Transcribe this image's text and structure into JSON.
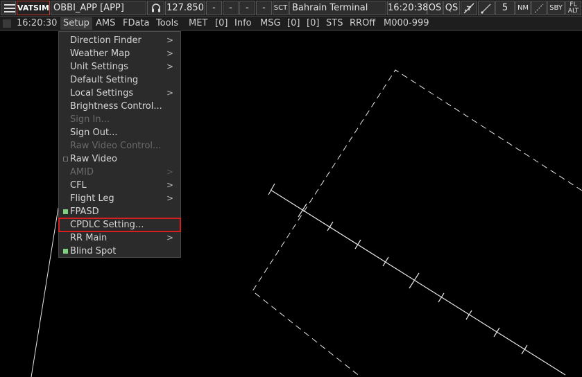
{
  "topbar": {
    "logo": "VATSIM",
    "position": "OBBI_APP [APP]",
    "frequency": "127.850",
    "dash1": "-",
    "dash2": "-",
    "dash3": "-",
    "dash4": "-",
    "sct_label": "SCT",
    "sector": "Bahrain Terminal",
    "time": "16:20:38",
    "os": "OS",
    "qs": "QS",
    "range_value": "5",
    "range_unit": "NM",
    "sby": "SBY",
    "fl": "FL",
    "alt": "ALT"
  },
  "menubar": {
    "time": "16:20:30",
    "items": [
      "Setup",
      "AMS",
      "FData",
      "Tools",
      "MET",
      "[0]",
      "Info",
      "MSG",
      "[0]",
      "[0]",
      "STS",
      "RROff",
      "M000-999"
    ]
  },
  "setup_menu": {
    "items": [
      {
        "label": "Direction Finder",
        "submenu": true,
        "enabled": true
      },
      {
        "label": "Weather Map",
        "submenu": true,
        "enabled": true
      },
      {
        "label": "Unit Settings",
        "submenu": true,
        "enabled": true
      },
      {
        "label": "Default Setting",
        "submenu": false,
        "enabled": true
      },
      {
        "label": "Local Settings",
        "submenu": true,
        "enabled": true
      },
      {
        "label": "Brightness Control...",
        "submenu": false,
        "enabled": true
      },
      {
        "label": "Sign In...",
        "submenu": false,
        "enabled": false
      },
      {
        "label": "Sign Out...",
        "submenu": false,
        "enabled": true
      },
      {
        "label": "Raw Video Control...",
        "submenu": false,
        "enabled": false
      },
      {
        "label": "Raw Video",
        "submenu": false,
        "enabled": true,
        "checkbox": "off"
      },
      {
        "label": "AMID",
        "submenu": true,
        "enabled": false
      },
      {
        "label": "CFL",
        "submenu": true,
        "enabled": true
      },
      {
        "label": "Flight Leg",
        "submenu": true,
        "enabled": true
      },
      {
        "label": "FPASD",
        "submenu": false,
        "enabled": true,
        "checkbox": "on"
      },
      {
        "label": "CPDLC Setting...",
        "submenu": false,
        "enabled": true,
        "highlighted": true
      },
      {
        "label": "RR Main",
        "submenu": true,
        "enabled": true
      },
      {
        "label": "Blind Spot",
        "submenu": false,
        "enabled": true,
        "checkbox": "on"
      }
    ],
    "submenu_arrow": ">"
  },
  "colors": {
    "background": "#000000",
    "highlight_outline": "#d81e1e",
    "check_on": "#7ecf7e",
    "logo_border": "#c0392b"
  }
}
